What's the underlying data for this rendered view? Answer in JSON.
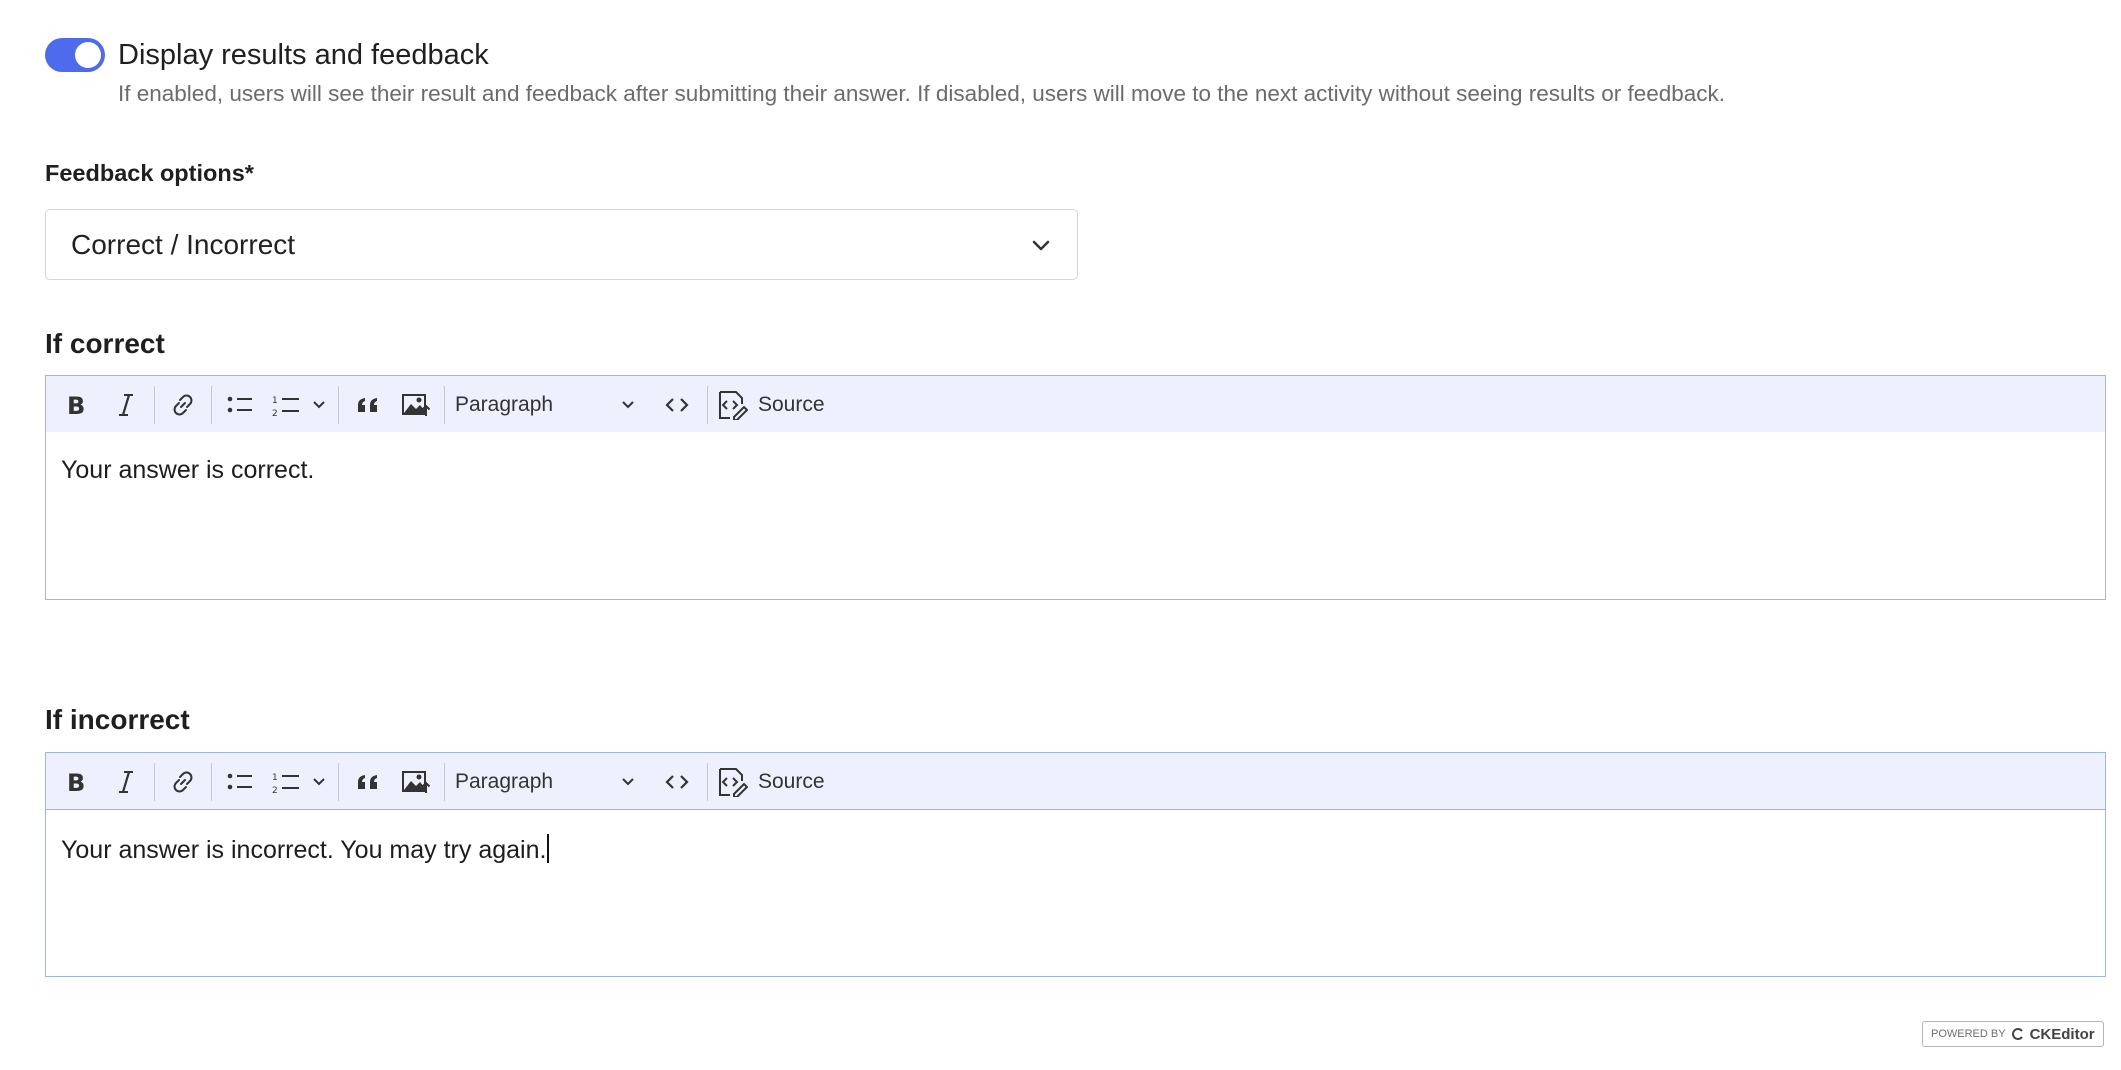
{
  "toggle": {
    "label": "Display results and feedback",
    "on": true,
    "help": "If enabled, users will see their result and feedback after submitting their answer. If disabled, users will move to the next activity without seeing results or feedback."
  },
  "feedback_options": {
    "label": "Feedback options*",
    "selected": "Correct / Incorrect"
  },
  "editors": [
    {
      "title": "If correct",
      "format": "Paragraph",
      "source_label": "Source",
      "content": "Your answer is correct."
    },
    {
      "title": "If incorrect",
      "format": "Paragraph",
      "source_label": "Source",
      "content": "Your answer is incorrect. You may try again."
    }
  ],
  "badge": {
    "powered_by": "POWERED BY",
    "brand": "CKEditor"
  },
  "colors": {
    "accent": "#4f6bed",
    "toolbar_bg": "#eef1fd"
  }
}
